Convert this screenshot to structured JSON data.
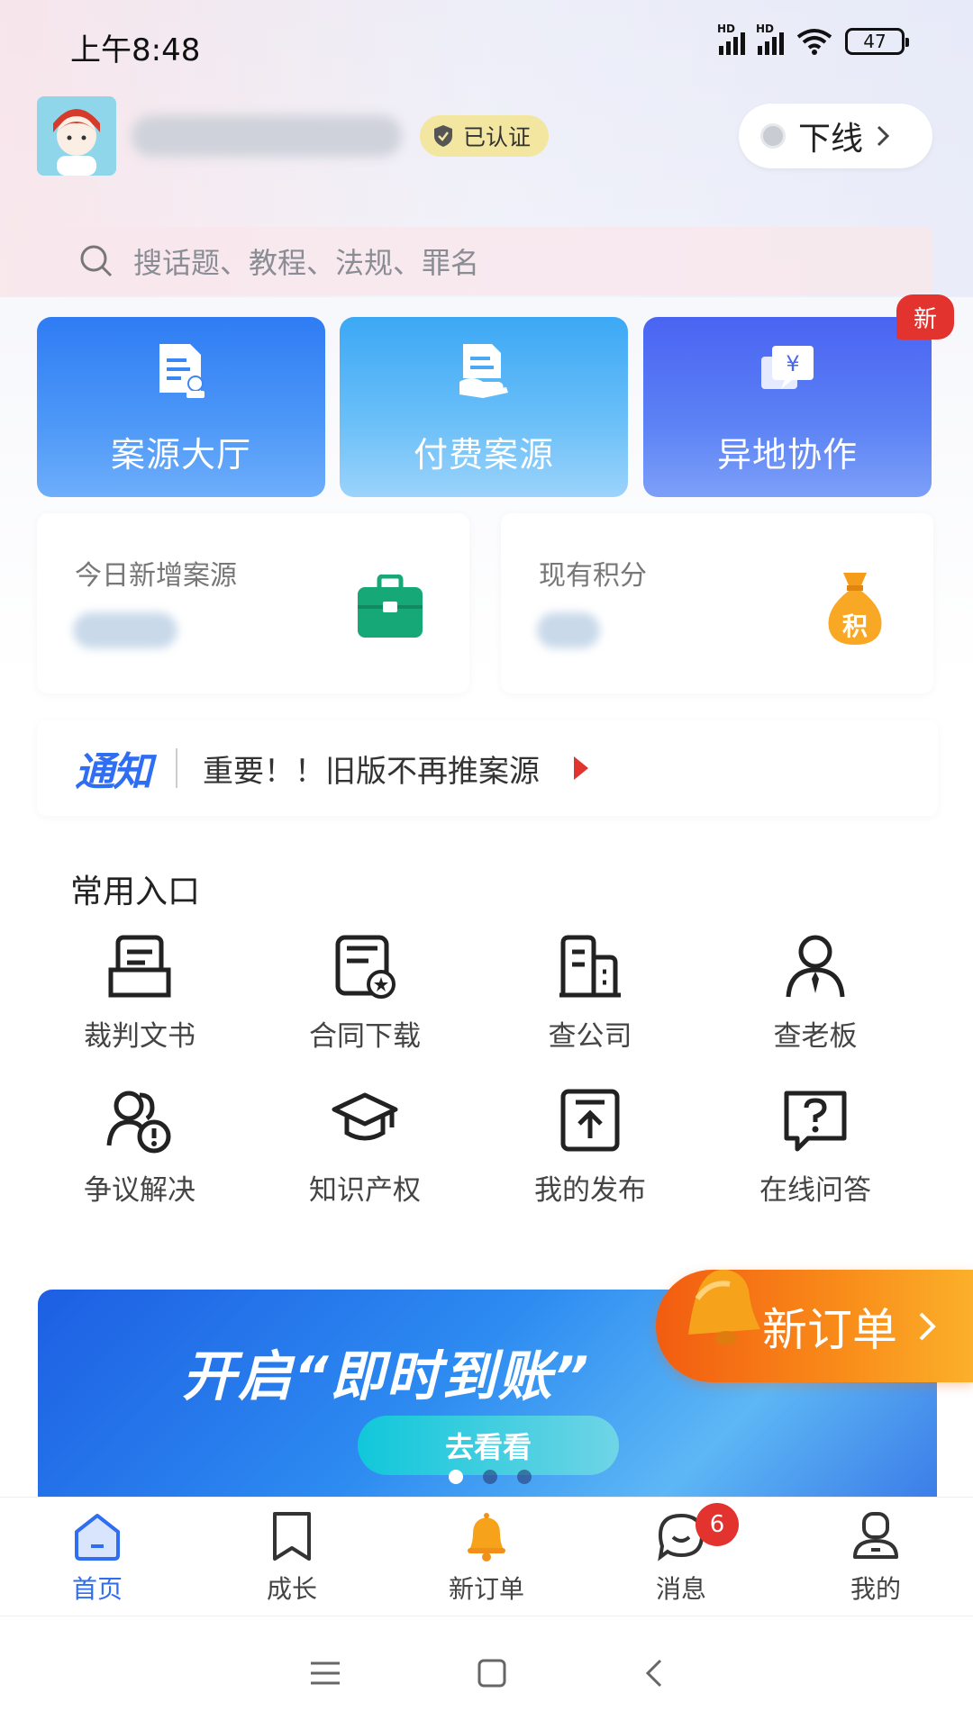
{
  "status_bar": {
    "time": "上午8:48",
    "network_label": "HD",
    "battery": "47"
  },
  "header": {
    "verified_label": "已认证",
    "offline_label": "下线"
  },
  "search": {
    "placeholder": "搜话题、教程、法规、罪名"
  },
  "big_cards": [
    {
      "label": "案源大厅"
    },
    {
      "label": "付费案源"
    },
    {
      "label": "异地协作"
    }
  ],
  "new_tag": "新",
  "stats": {
    "today_new_cases_label": "今日新增案源",
    "points_label": "现有积分",
    "points_icon_text": "积"
  },
  "notice": {
    "logo": "通知",
    "text": "重要！！旧版不再推案源"
  },
  "quick_entry": {
    "title": "常用入口",
    "items": [
      {
        "label": "裁判文书",
        "icon": "judgment-doc-icon"
      },
      {
        "label": "合同下载",
        "icon": "contract-icon"
      },
      {
        "label": "查公司",
        "icon": "company-icon"
      },
      {
        "label": "查老板",
        "icon": "boss-icon"
      },
      {
        "label": "争议解决",
        "icon": "dispute-icon"
      },
      {
        "label": "知识产权",
        "icon": "graduation-cap-icon"
      },
      {
        "label": "我的发布",
        "icon": "publish-icon"
      },
      {
        "label": "在线问答",
        "icon": "question-icon"
      }
    ]
  },
  "banner": {
    "title": "开启“即时到账”",
    "button": "去看看",
    "pages": 3,
    "current_page": 1
  },
  "float_button": {
    "label": "新订单"
  },
  "tabbar": {
    "items": [
      {
        "label": "首页",
        "icon": "home-icon",
        "active": true
      },
      {
        "label": "成长",
        "icon": "bookmark-icon"
      },
      {
        "label": "新订单",
        "icon": "bell-icon"
      },
      {
        "label": "消息",
        "icon": "message-icon",
        "badge": "6"
      },
      {
        "label": "我的",
        "icon": "profile-icon"
      }
    ]
  },
  "colors": {
    "primary": "#2f6df2",
    "accent_red": "#e3332f",
    "orange": "#f98d1a",
    "green": "#16a876"
  }
}
